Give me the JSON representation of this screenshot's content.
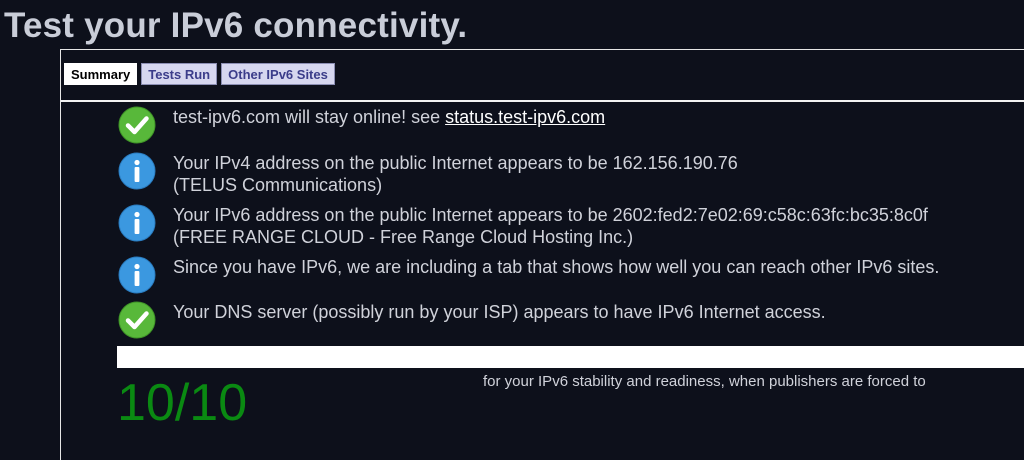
{
  "page": {
    "title": "Test your IPv6 connectivity."
  },
  "tabs": [
    {
      "label": "Summary",
      "active": true
    },
    {
      "label": "Tests Run",
      "active": false
    },
    {
      "label": "Other IPv6 Sites",
      "active": false
    }
  ],
  "results": [
    {
      "icon": "check-icon",
      "line1": "test-ipv6.com will stay online! see ",
      "link_text": "status.test-ipv6.com",
      "line2": ""
    },
    {
      "icon": "info-icon",
      "line1": "Your IPv4 address on the public Internet appears to be 162.156.190.76",
      "line2": "(TELUS Communications)"
    },
    {
      "icon": "info-icon",
      "line1": "Your IPv6 address on the public Internet appears to be 2602:fed2:7e02:69:c58c:63fc:bc35:8c0f",
      "line2": "(FREE RANGE CLOUD - Free Range Cloud Hosting Inc.)"
    },
    {
      "icon": "info-icon",
      "line1": "Since you have IPv6, we are including a tab that shows how well you can reach other IPv6 sites.",
      "line2": ""
    },
    {
      "icon": "check-icon",
      "line1": "Your DNS server (possibly run by your ISP) appears to have IPv6 Internet access.",
      "line2": ""
    }
  ],
  "score": {
    "value": "10/10",
    "description": "for your IPv6 stability and readiness, when publishers are forced to"
  },
  "colors": {
    "check_green": "#58b83a",
    "info_blue": "#3b98e0",
    "score_green": "#0a8a12"
  }
}
